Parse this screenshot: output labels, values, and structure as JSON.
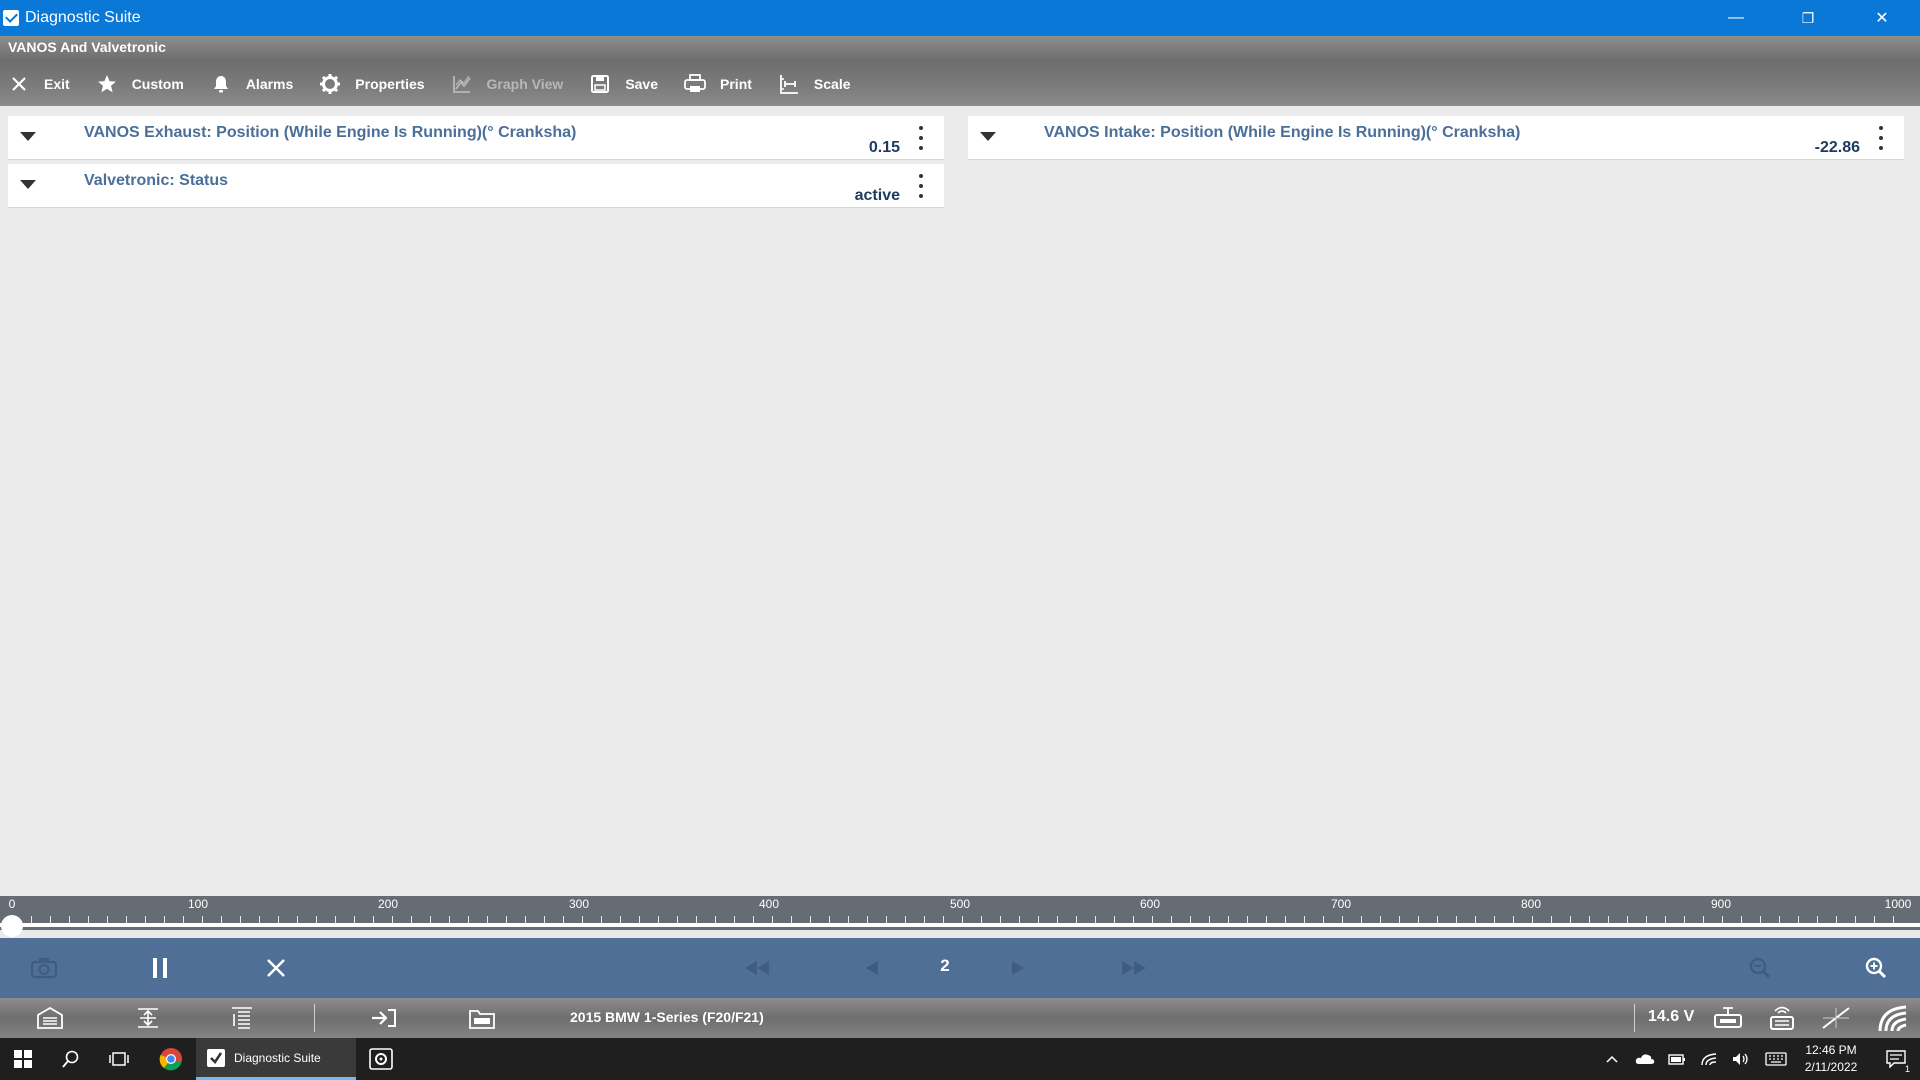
{
  "window": {
    "title": "Diagnostic Suite",
    "controls": {
      "minimize": "—",
      "restore": "❐",
      "close": "✕"
    }
  },
  "module": {
    "title": "VANOS And Valvetronic"
  },
  "toolbar": {
    "exit": "Exit",
    "custom": "Custom",
    "alarms": "Alarms",
    "properties": "Properties",
    "graph_view": "Graph View",
    "save": "Save",
    "print": "Print",
    "scale": "Scale"
  },
  "parameters": [
    {
      "name": "VANOS Exhaust: Position (While Engine Is Running)(° Cranksha)",
      "value": "0.15"
    },
    {
      "name": "Valvetronic: Status",
      "value": "active"
    },
    {
      "name": "VANOS Intake: Position (While Engine Is Running)(° Cranksha)",
      "value": "-22.86"
    }
  ],
  "timeline": {
    "labels": [
      "0",
      "100",
      "200",
      "300",
      "400",
      "500",
      "600",
      "700",
      "800",
      "900",
      "1000"
    ],
    "position": 0
  },
  "playback": {
    "page": "2"
  },
  "status": {
    "vehicle": "2015 BMW 1-Series (F20/F21)",
    "voltage": "14.6 V"
  },
  "taskbar": {
    "app_label": "Diagnostic Suite",
    "time": "12:46 PM",
    "date": "2/11/2022",
    "notification_count": "1"
  },
  "colors": {
    "titlebar": "#0a78d7",
    "param_name": "#4a6f99",
    "param_value": "#1d3a5f",
    "playbar": "#4f6f97"
  }
}
